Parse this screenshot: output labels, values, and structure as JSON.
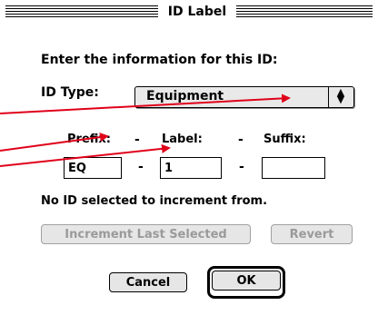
{
  "window": {
    "title": "ID Label"
  },
  "form": {
    "heading": "Enter the information for this ID:",
    "id_type_label": "ID Type:",
    "id_type_value": "Equipment",
    "prefix_label": "Prefix:",
    "label_label": "Label:",
    "suffix_label": "Suffix:",
    "separator": "-",
    "prefix_value": "EQ",
    "label_value": "1",
    "suffix_value": "",
    "status_text": "No ID selected to increment from."
  },
  "buttons": {
    "increment": "Increment Last Selected",
    "revert": "Revert",
    "cancel": "Cancel",
    "ok": "OK"
  },
  "annotation": {
    "arrow_color": "#e0001a"
  }
}
